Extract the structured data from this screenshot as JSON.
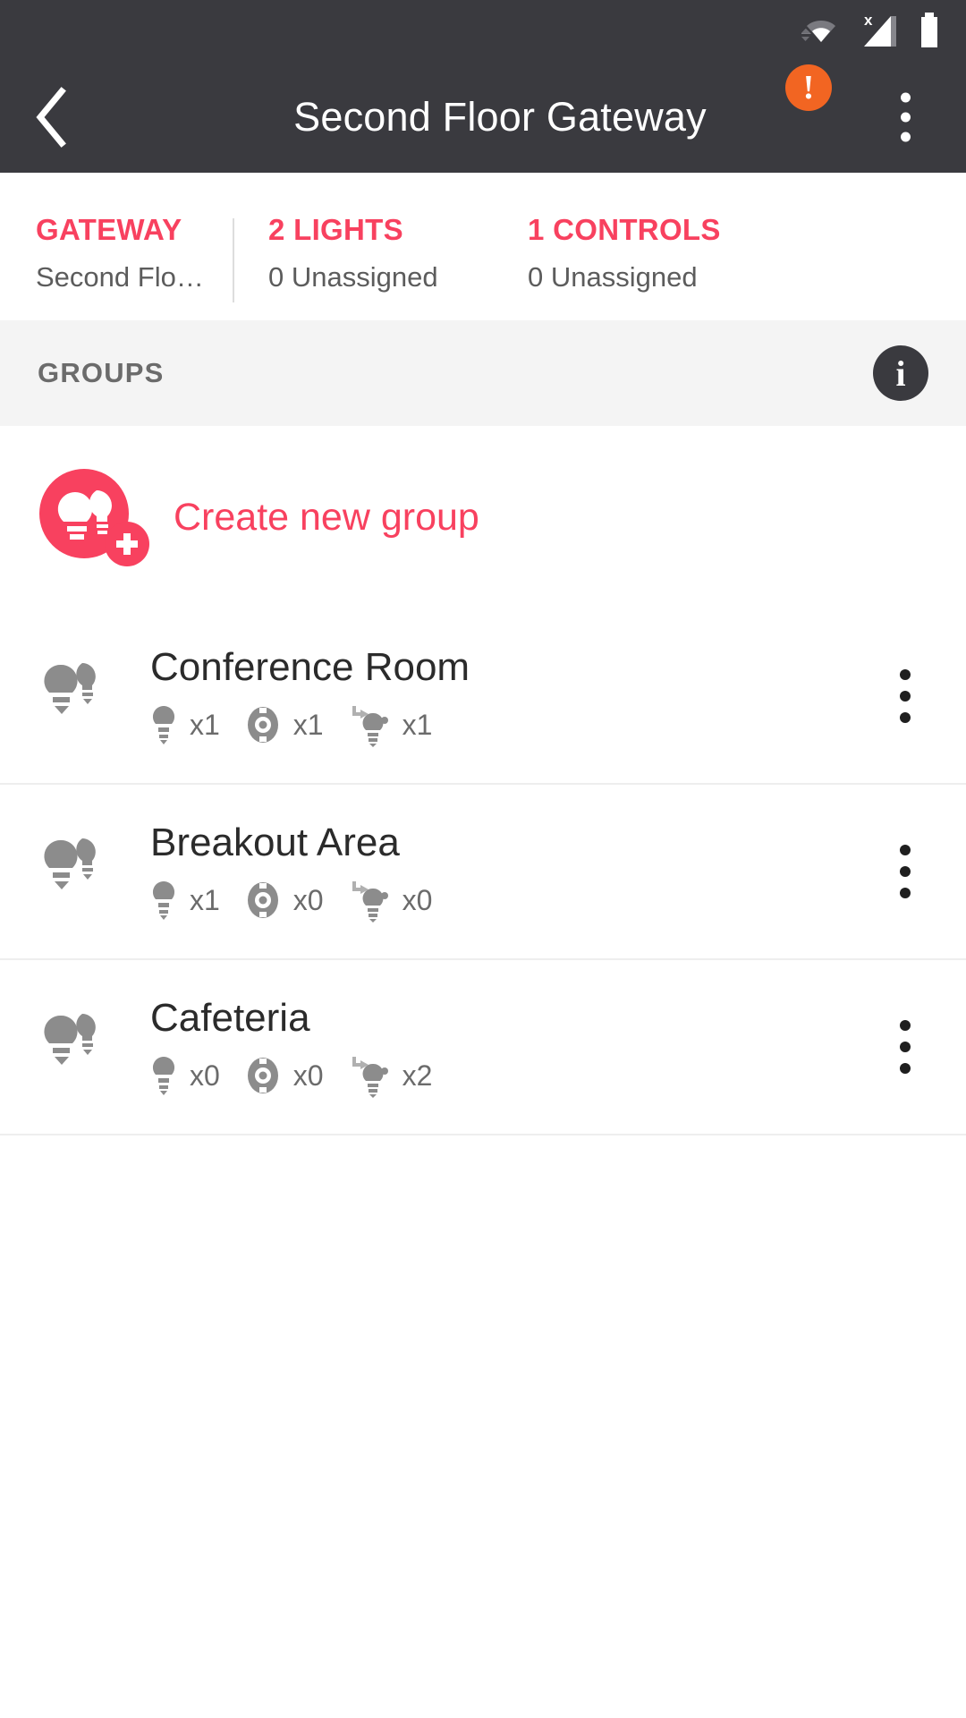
{
  "statusbar": {
    "icons": [
      {
        "name": "wifi-icon",
        "label": "wifi"
      },
      {
        "name": "cellular-no-service-icon",
        "label": "cellular signal with X"
      },
      {
        "name": "battery-icon",
        "label": "battery full"
      }
    ]
  },
  "appbar": {
    "back_label": "‹",
    "title": "Second Floor Gateway",
    "warning_badge": "!",
    "warning_color": "#f26522",
    "overflow_label": "more options"
  },
  "stats": {
    "items": [
      {
        "title": "GATEWAY",
        "subtitle": "Second Flo…",
        "divider": false
      },
      {
        "title": "2 LIGHTS",
        "subtitle": "0 Unassigned",
        "divider": true
      },
      {
        "title": "1 CONTROLS",
        "subtitle": "0 Unassigned",
        "divider": false
      }
    ],
    "accent_color": "#f8415f"
  },
  "groups_header": {
    "label": "GROUPS",
    "info_label": "i"
  },
  "create_group": {
    "label": "Create new group",
    "plus_label": "+",
    "color": "#f8415f"
  },
  "groups": [
    {
      "name": "Conference Room",
      "meta": [
        {
          "icon": "bulb-icon",
          "count": "x1"
        },
        {
          "icon": "sensor-icon",
          "count": "x1"
        },
        {
          "icon": "switch-icon",
          "count": "x1"
        }
      ]
    },
    {
      "name": "Breakout Area",
      "meta": [
        {
          "icon": "bulb-icon",
          "count": "x1"
        },
        {
          "icon": "sensor-icon",
          "count": "x0"
        },
        {
          "icon": "switch-icon",
          "count": "x0"
        }
      ]
    },
    {
      "name": "Cafeteria",
      "meta": [
        {
          "icon": "bulb-icon",
          "count": "x0"
        },
        {
          "icon": "sensor-icon",
          "count": "x0"
        },
        {
          "icon": "switch-icon",
          "count": "x2"
        }
      ]
    }
  ]
}
